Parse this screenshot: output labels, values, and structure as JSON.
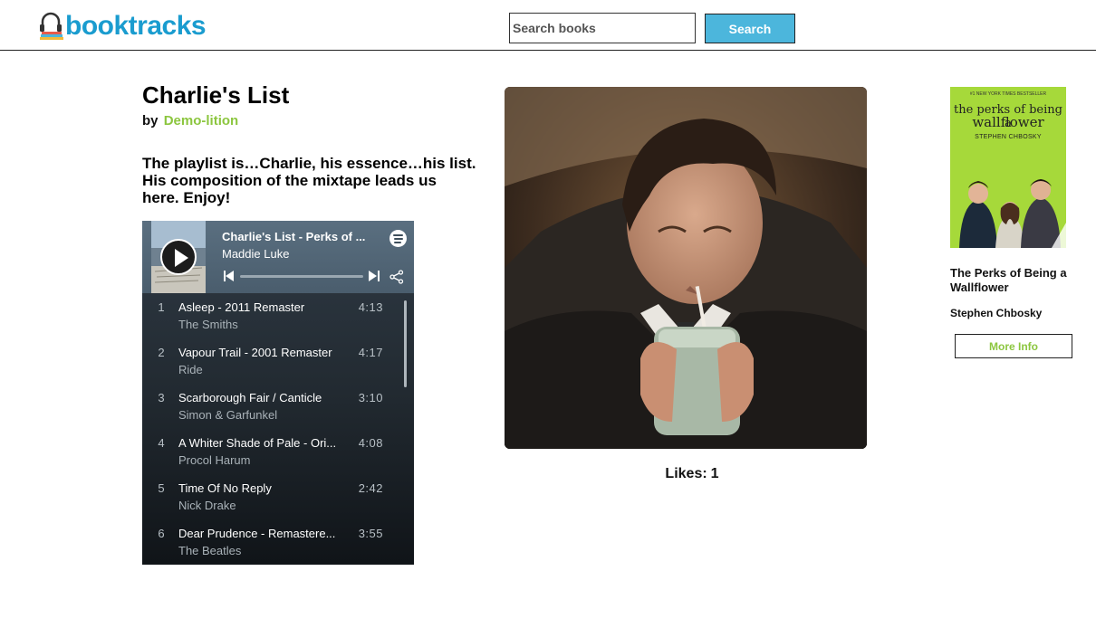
{
  "header": {
    "brand": "booktracks",
    "search_placeholder": "Search books",
    "search_label": "Search"
  },
  "playlist": {
    "title": "Charlie's List",
    "by_label": "by",
    "author": "Demo-lition",
    "description": "The playlist is…Charlie, his essence…his list. His composition of the mixtape leads us here. Enjoy!",
    "likes_label": "Likes:",
    "likes_count": "1"
  },
  "spotify": {
    "playlist_name": "Charlie's List - Perks of ...",
    "owner": "Maddie Luke",
    "tracks": [
      {
        "num": "1",
        "name": "Asleep - 2011 Remaster",
        "artist": "The Smiths",
        "duration": "4:13"
      },
      {
        "num": "2",
        "name": "Vapour Trail - 2001 Remaster",
        "artist": "Ride",
        "duration": "4:17"
      },
      {
        "num": "3",
        "name": "Scarborough Fair / Canticle",
        "artist": "Simon & Garfunkel",
        "duration": "3:10"
      },
      {
        "num": "4",
        "name": "A Whiter Shade of Pale - Ori...",
        "artist": "Procol Harum",
        "duration": "4:08"
      },
      {
        "num": "5",
        "name": "Time Of No Reply",
        "artist": "Nick Drake",
        "duration": "2:42"
      },
      {
        "num": "6",
        "name": "Dear Prudence - Remastere...",
        "artist": "The Beatles",
        "duration": "3:55"
      }
    ]
  },
  "book": {
    "cover_tagline": "#1 NEW YORK TIMES BESTSELLER",
    "cover_title_top": "the perks of being a",
    "cover_title_main": "wallflower",
    "cover_author": "STEPHEN CHBOSKY",
    "title": "The Perks of Being a Wallflower",
    "author": "Stephen Chbosky",
    "more_info_label": "More Info"
  },
  "colors": {
    "brand": "#1a9ccf",
    "search_button": "#4cb6dc",
    "accent_green": "#8cc63f",
    "cover_green": "#a6d93a"
  }
}
